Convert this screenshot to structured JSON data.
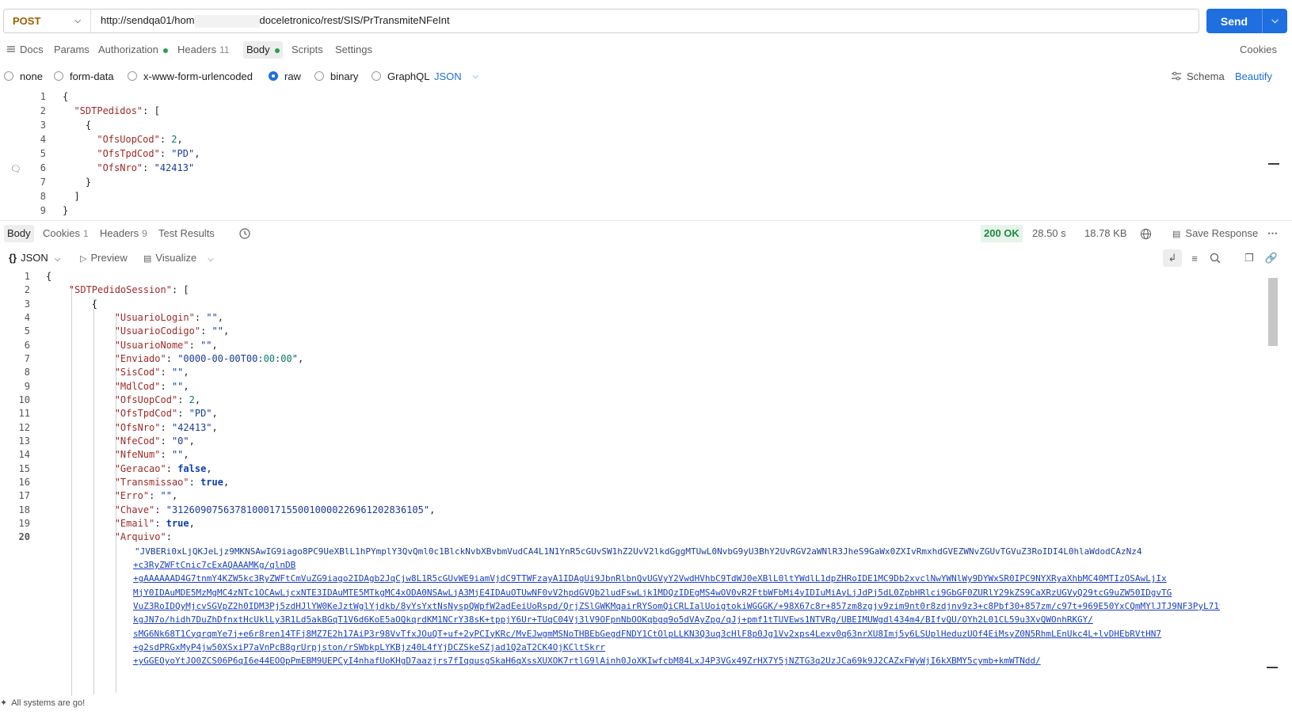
{
  "request": {
    "method": "POST",
    "url_left": "http://sendqa01/hom",
    "url_right": "doceletronico/rest/SIS/PrTransmiteNFeInt",
    "send_label": "Send"
  },
  "request_tabs": [
    {
      "label": "Docs"
    },
    {
      "label": "Params"
    },
    {
      "label": "Authorization"
    },
    {
      "label": "Headers",
      "count": "11"
    },
    {
      "label": "Body"
    },
    {
      "label": "Scripts"
    },
    {
      "label": "Settings"
    }
  ],
  "cookies_label": "Cookies",
  "body_types": [
    "none",
    "form-data",
    "x-www-form-urlencoded",
    "raw",
    "binary",
    "GraphQL"
  ],
  "body_format": "JSON",
  "schema_label": "Schema",
  "beautify_label": "Beautify",
  "request_body_lines": [
    "{",
    "  \"SDTPedidos\": [",
    "    {",
    "      \"OfsUopCod\": 2,",
    "      \"OfsTpdCod\": \"PD\",",
    "      \"OfsNro\": \"42413\"",
    "    }",
    "  ]",
    "}"
  ],
  "response_tabs": [
    {
      "label": "Body"
    },
    {
      "label": "Cookies",
      "count": "1"
    },
    {
      "label": "Headers",
      "count": "9"
    },
    {
      "label": "Test Results"
    }
  ],
  "response_status": {
    "code": "200 OK",
    "time": "28.50 s",
    "size": "18.78 KB",
    "save_response": "Save Response",
    "status_color": "#1e8a45"
  },
  "view_mode": "JSON",
  "preview_label": "Preview",
  "visualize_label": "Visualize",
  "response_lines": [
    "{",
    "    \"SDTPedidoSession\": [",
    "        {",
    "            \"UsuarioLogin\": \"\",",
    "            \"UsuarioCodigo\": \"\",",
    "            \"UsuarioNome\": \"\",",
    "            \"Enviado\": \"0000-00-00T00:00:00\",",
    "            \"SisCod\": \"\",",
    "            \"MdlCod\": \"\",",
    "            \"OfsUopCod\": 2,",
    "            \"OfsTpdCod\": \"PD\",",
    "            \"OfsNro\": \"42413\",",
    "            \"NfeCod\": \"0\",",
    "            \"NfeNum\": \"\",",
    "            \"Geracao\": false,",
    "            \"Transmissao\": true,",
    "            \"Erro\": \"\",",
    "            \"Chave\": \"31260907563781000171550010000226961202836105\",",
    "            \"Email\": true,",
    "            \"Arquivo\":"
  ],
  "arquivo_lines": [
    "\"JVBERi0xLjQKJeLjz9MKNSAwIG9iago8PC9UeXBlL1hPYmplY3QvQml0c1BlckNvbXBvbmVudCA4L1N1YnR5cGUvSW1hZ2UvV2lkdGggMTUwL0NvbG9yU3BhY2UvRGV2aWNlR3JheS9GaWx0ZXIvRmxhdGVEZWNvZGUvTGVuZ3RoIDI4L0hlaWdodCAzNz4",
    "+c3RyZWFtCnic7cExAQAAAMKg/qlnDB",
    "+gAAAAAAD4G7tnmY4KZW5kc3RyZWFtCmVuZG9iago2IDAgb2JqCjw8L1R5cGUvWE9iamVjdC9TTWFzayA1IDAgUi9JbnRlbnQvUGVyY2VwdHVhbC9TdWJ0eXBlL0ltYWdlL1dpZHRoIDE1MC9Db2xvclNwYWNlWy9DYWxSR0IPC9NYXRyaXhbMC40MTIzOSAwLjIx",
    "MjY0IDAuMDE5MzMgMC4zNTc1OCAwLjcxNTE3IDAuMTE5MTkgMC4xODA0NSAwLjA3MjE4IDAuOTUwNF0vV2hpdGVQb2ludFswLjk1MDQzIDEgMS4wOV0vR2FtbWFbMi4yIDIuMiAyLjJdPj5dL0ZpbHRlci9GbGF0ZURlY29kZS9CaXRzUGVyQ29tcG9uZW50IDgvTG",
    "VuZ3RoIDQyMjcvSGVpZ2h0IDM3Pj5zdHJlYW0KeJztWglYjdkb/8yYsYxtNsNyspQWpfW2adEeiUoRspd/QrjZSlGWKMqairRYSomQiCRLIalUoigtokiWGGGK/+98X67c8r+857zm8zgjv9zim9nt0r8zdjnv9z3+c8Pbf30+857zm/c97t+969E50YxCQmMYlJTJ9NF3PyL71v56/",
    "kgJN7o/hidh7DuZhDfnxtHcUklLy3R1Ld5akBGqT1V6d6KoE5aOQkqrdKM1NCrY38sK+tppjY6Ur+TUqC04Vj3lV9OFpnNbOOKqbgq9o5dVAyZpg/qJj+pmf1tTUVEws1NTVRg/UBEIMUWgdl434m4/BIfvQU/OYh2L01CL59u3XvQWOnhRKGY/",
    "sMG6Nk68T1CyqrqmYe7j+e6r8ren14TFj8MZ7E2h17AiP3r98VvTfxJOuQT+uf+2yPCIyKRc/MvEJwgmMSNoTHBEbGegdFNDY1CtOlpLLKN3Q3uq3cHlF8p0Jg1Vv2xps4Lexv0q63nrXU8Imj5y6LSUplHeduzUOf4EiMsyZ0N5RhmLEnUkc4L+lvDHEbRVtHN7",
    "+g2sdPRGxMyP4jw50XSxiP7aVnPcB8grUrpjston/rSWbkpLYKBjz40L4fYjDCZSkeSZjad1Q2aT2CK4OjKCltSkrr",
    "+yGGEOyoYtJO0ZCS06P6qI6e44EOOpPmEBM9UEPCyI4nhafUoKHgD7aazjrs7fIqqusgSkaH6qXssXUXOK7rtlG9lAinh0JoXKIwfcbM84LxJ4P3VGx49ZrHX7Y5jNZTG3q2UzJCa69k9J2CAZxFWyWjI6kXBMY5cymb+kmWTNdd/"
  ],
  "footer_status": "All systems are go!"
}
